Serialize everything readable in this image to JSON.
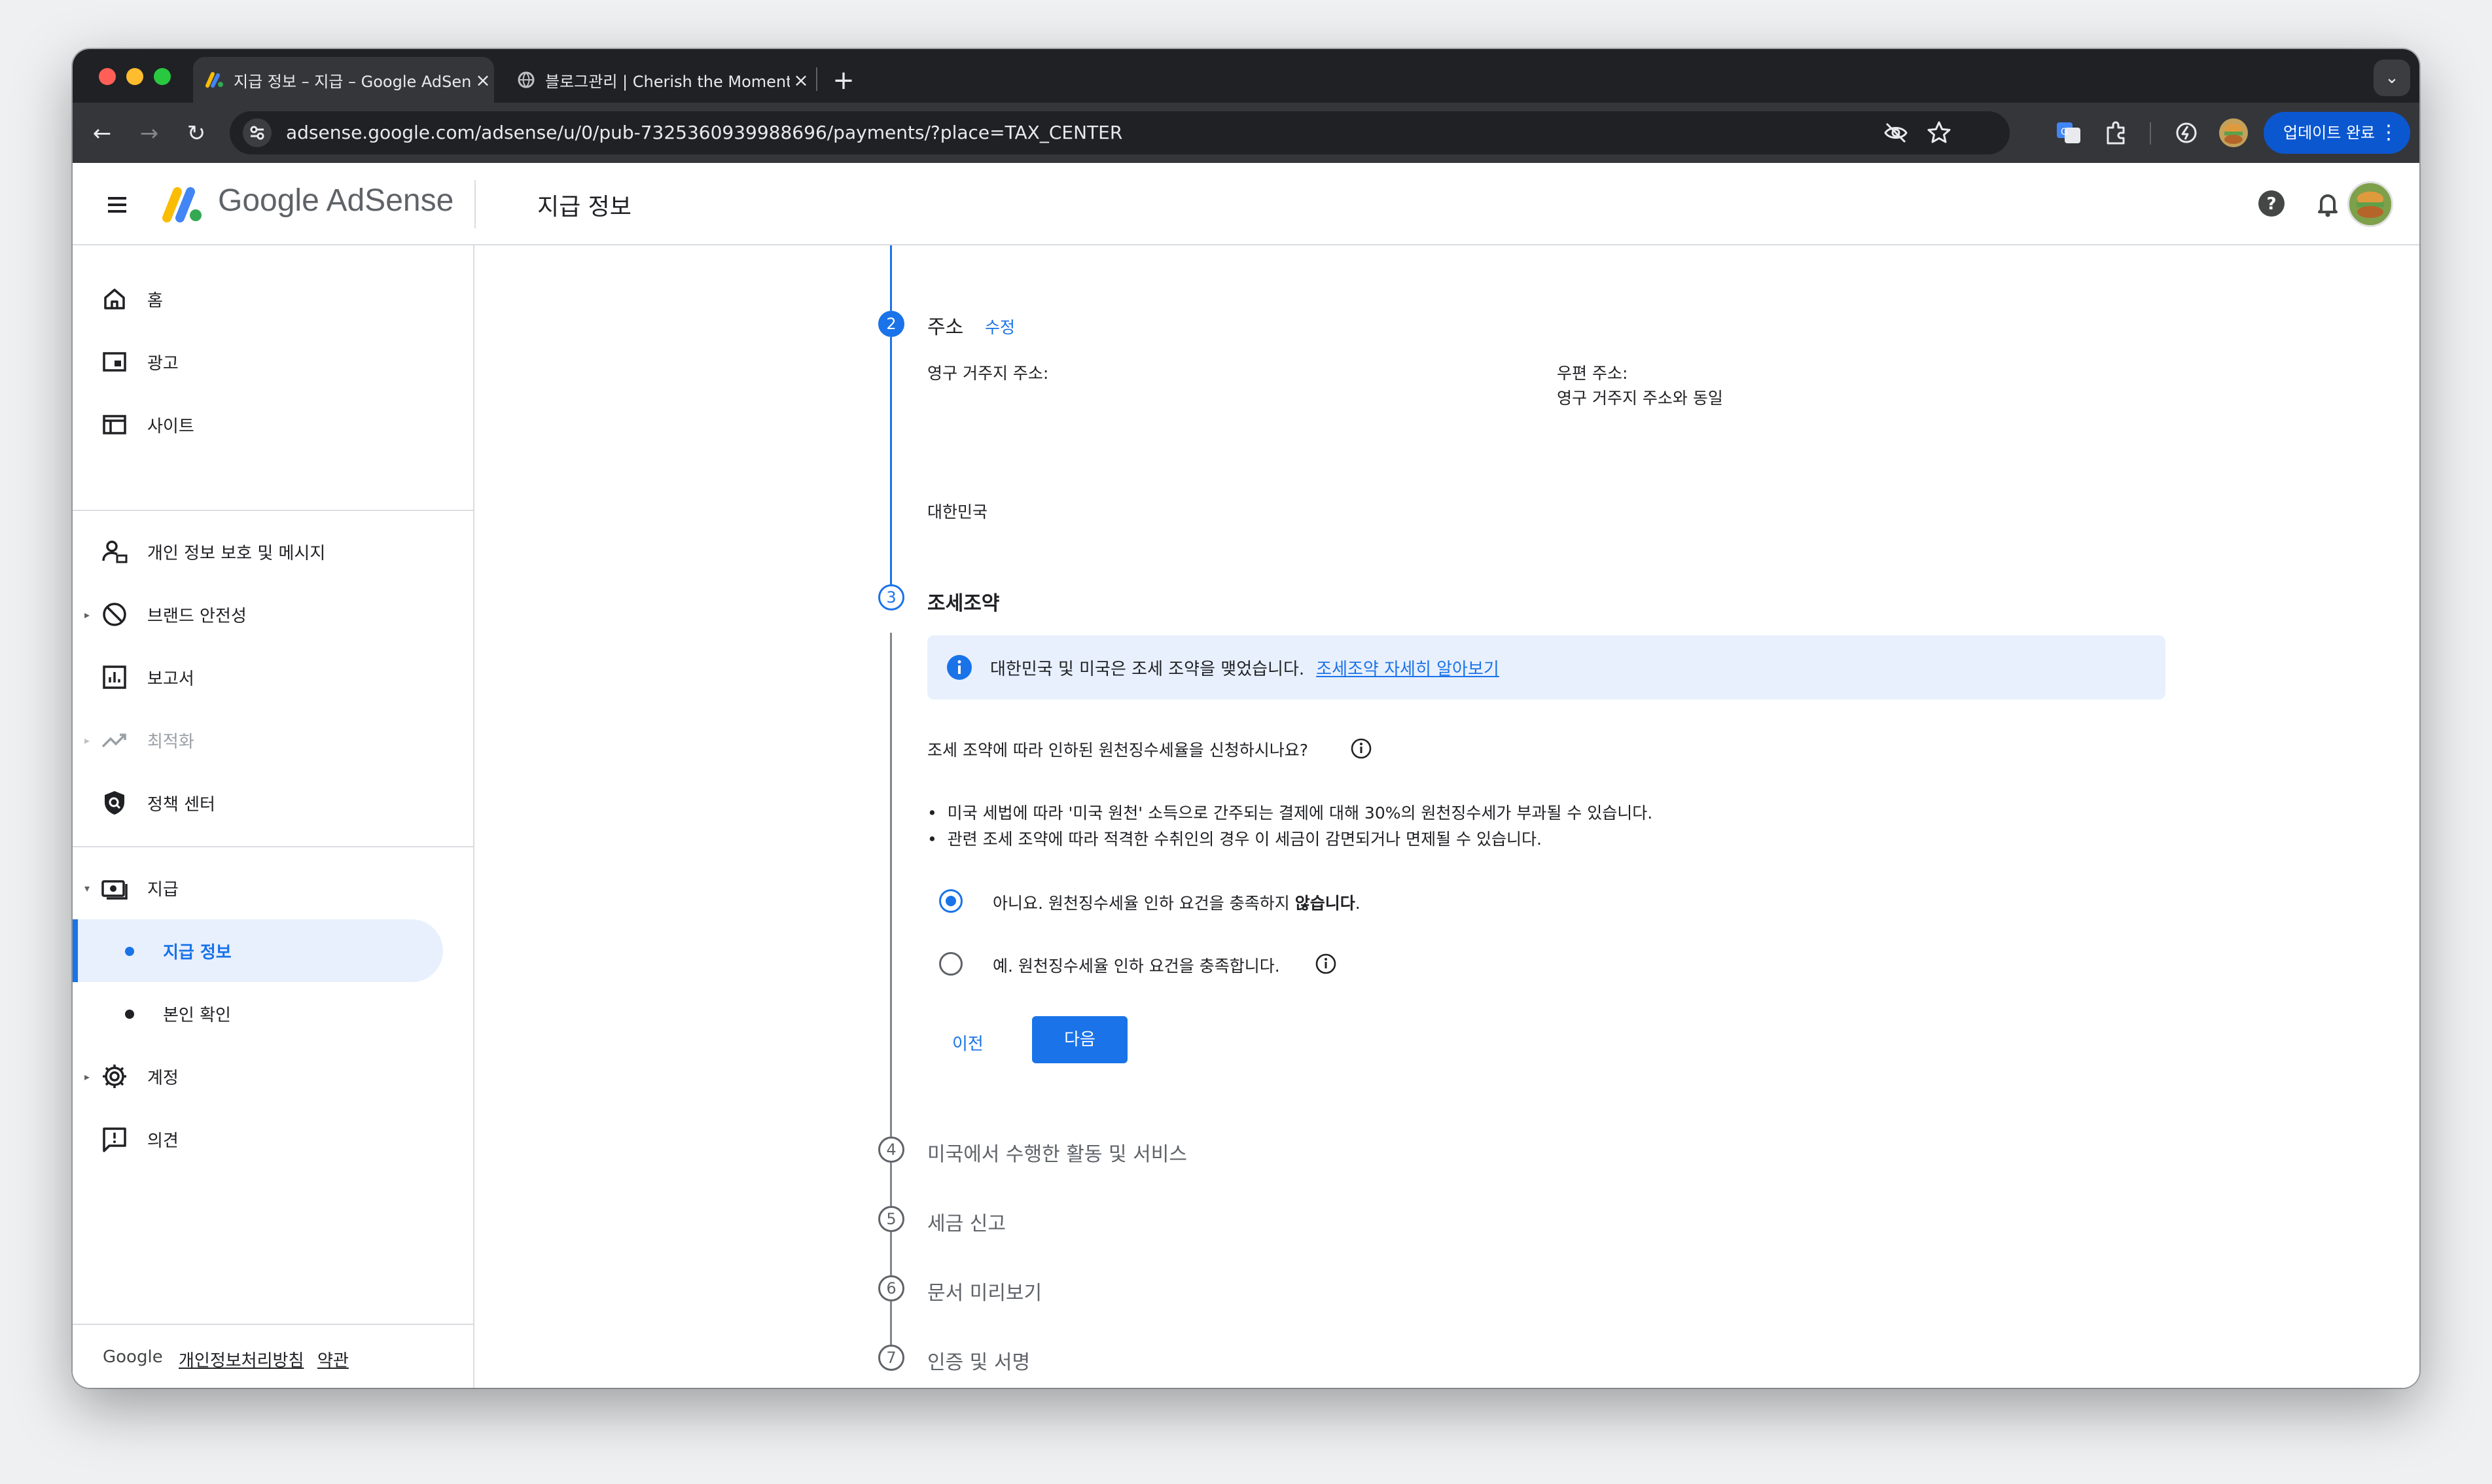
{
  "browser": {
    "tabs": [
      {
        "title": "지급 정보 – 지급 – Google AdSense",
        "active": true
      },
      {
        "title": "블로그관리 | Cherish the Moment",
        "active": false
      }
    ],
    "url": "adsense.google.com/adsense/u/0/pub-7325360939988696/payments/?place=TAX_CENTER",
    "update_button": "업데이트 완료"
  },
  "header": {
    "brand_google": "Google",
    "brand_product": "AdSense",
    "page_title": "지급 정보"
  },
  "sidebar": {
    "items": [
      {
        "label": "홈",
        "icon": "home-icon"
      },
      {
        "label": "광고",
        "icon": "ads-icon"
      },
      {
        "label": "사이트",
        "icon": "sites-icon"
      },
      {
        "label": "개인 정보 보호 및 메시지",
        "icon": "privacy-icon"
      },
      {
        "label": "브랜드 안전성",
        "icon": "block-icon"
      },
      {
        "label": "보고서",
        "icon": "report-icon"
      },
      {
        "label": "최적화",
        "icon": "trending-icon"
      },
      {
        "label": "정책 센터",
        "icon": "policy-icon"
      },
      {
        "label": "지급",
        "icon": "payments-icon"
      },
      {
        "label": "지급 정보",
        "icon": "dot"
      },
      {
        "label": "본인 확인",
        "icon": "dot"
      },
      {
        "label": "계정",
        "icon": "gear-icon"
      },
      {
        "label": "의견",
        "icon": "feedback-icon"
      }
    ],
    "footer": {
      "google": "Google",
      "privacy": "개인정보처리방침",
      "terms": "약관"
    }
  },
  "form": {
    "step2": {
      "number": "2",
      "title": "주소",
      "edit": "수정",
      "permanent_label": "영구 거주지 주소:",
      "mailing_label": "우편 주소:",
      "mailing_value": "영구 거주지 주소와 동일",
      "country": "대한민국"
    },
    "step3": {
      "number": "3",
      "title": "조세조약",
      "info_text": "대한민국 및 미국은 조세 조약을 맺었습니다.",
      "info_link": "조세조약 자세히 알아보기",
      "question": "조세 조약에 따라 인하된 원천징수세율을 신청하시나요?",
      "bullets": [
        "미국 세법에 따라 '미국 원천' 소득으로 간주되는 결제에 대해 30%의 원천징수세가 부과될 수 있습니다.",
        "관련 조세 조약에 따라 적격한 수취인의 경우 이 세금이 감면되거나 면제될 수 있습니다."
      ],
      "option_no_prefix": "아니요. 원천징수세율 인하 요건을 충족하지 ",
      "option_no_bold": "않습니다",
      "option_no_suffix": ".",
      "option_yes": "예. 원천징수세율 인하 요건을 충족합니다.",
      "selected": "no",
      "back_button": "이전",
      "next_button": "다음"
    },
    "future_steps": [
      {
        "number": "4",
        "title": "미국에서 수행한 활동 및 서비스"
      },
      {
        "number": "5",
        "title": "세금 신고"
      },
      {
        "number": "6",
        "title": "문서 미리보기"
      },
      {
        "number": "7",
        "title": "인증 및 서명"
      }
    ]
  },
  "colors": {
    "accent": "#1a73e8",
    "selected_bg": "#e8f0fe"
  }
}
